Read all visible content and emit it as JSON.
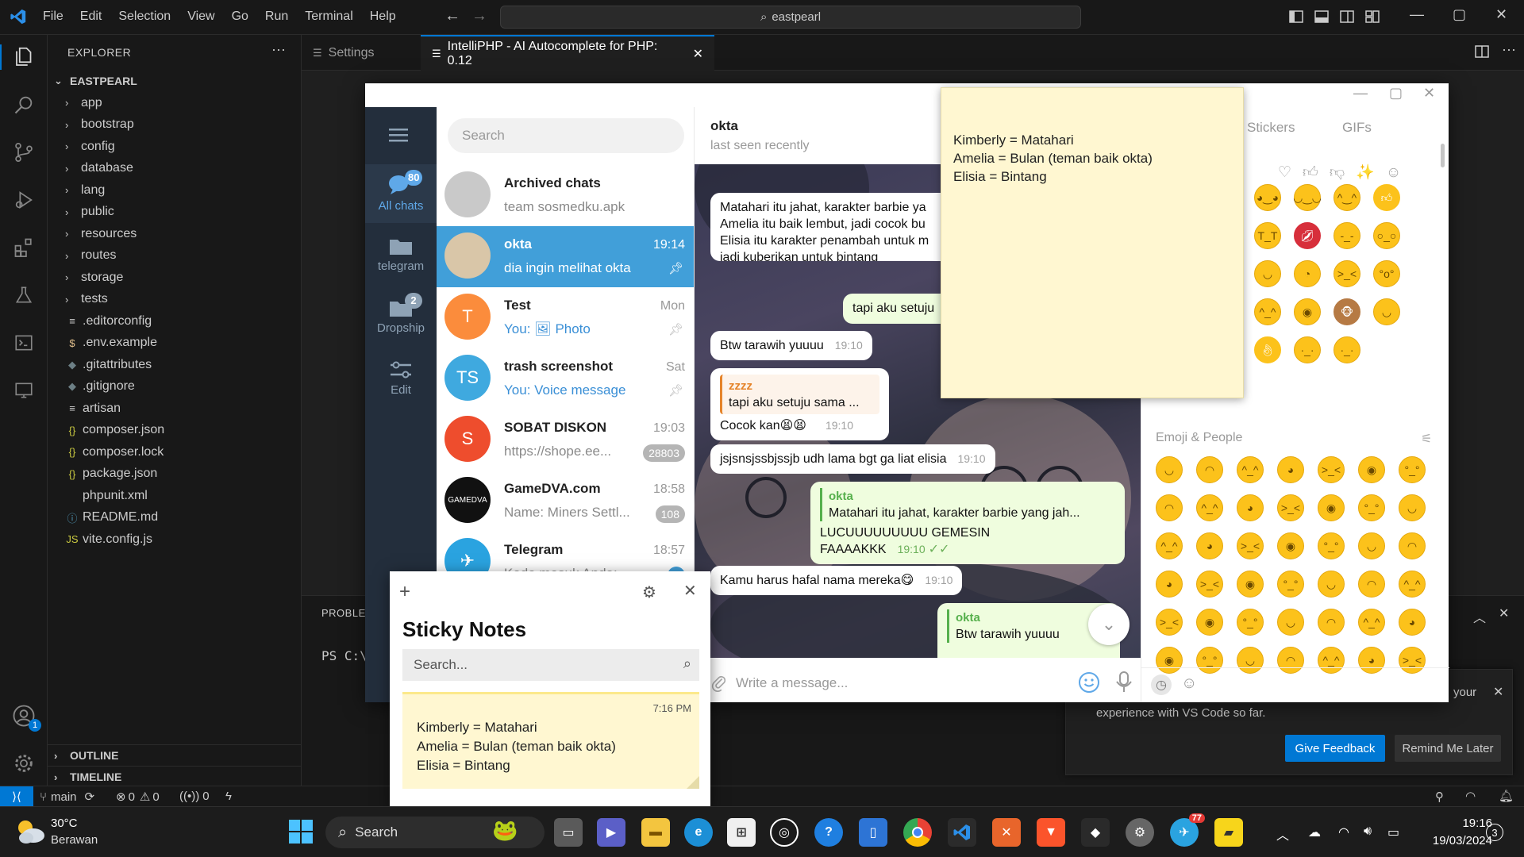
{
  "vscode": {
    "menu": [
      "File",
      "Edit",
      "Selection",
      "View",
      "Go",
      "Run",
      "Terminal",
      "Help"
    ],
    "search": "eastpearl",
    "explorer_title": "EXPLORER",
    "root_folder": "EASTPEARL",
    "folders": [
      "app",
      "bootstrap",
      "config",
      "database",
      "lang",
      "public",
      "resources",
      "routes",
      "storage",
      "tests"
    ],
    "files": [
      ".editorconfig",
      ".env.example",
      ".gitattributes",
      ".gitignore",
      "artisan",
      "composer.json",
      "composer.lock",
      "package.json",
      "phpunit.xml",
      "README.md",
      "vite.config.js"
    ],
    "outline": "OUTLINE",
    "timeline": "TIMELINE",
    "tab_settings": "Settings",
    "tab_active": "IntelliPHP - AI Autocomplete for PHP: 0.12",
    "panel_tab": "PROBLEM",
    "terminal_prompt": "PS C:\\",
    "accounts_badge": "1",
    "status": {
      "branch": "main",
      "errors": "0",
      "warnings": "0",
      "ports": "0"
    },
    "notification": {
      "text_tail": "your",
      "text_line2": "experience with VS Code so far.",
      "feedback_button": "Give Feedback",
      "later_button": "Remind Me Later"
    }
  },
  "telegram": {
    "search_placeholder": "Search",
    "nav": [
      {
        "label": "All chats",
        "badge": "80"
      },
      {
        "label": "telegram",
        "badge": ""
      },
      {
        "label": "Dropship",
        "badge": "2"
      },
      {
        "label": "Edit",
        "badge": ""
      }
    ],
    "chats": [
      {
        "name": "Archived chats",
        "msg": "team sosmedku.apk",
        "time": "",
        "badge": "",
        "avatar": "",
        "color": "#c9c9c9"
      },
      {
        "name": "okta",
        "msg": "dia ingin melihat okta te...",
        "time": "19:14",
        "badge": "",
        "avatar": "",
        "color": "#d9c6a8"
      },
      {
        "name": "Test",
        "msg": "You: 🖼 Photo",
        "time": "Mon",
        "badge": "",
        "avatar": "T",
        "color": "#fb8c3c"
      },
      {
        "name": "trash screenshot",
        "msg": "You: Voice message",
        "time": "Sat",
        "badge": "",
        "avatar": "TS",
        "color": "#3fa9df"
      },
      {
        "name": "SOBAT DISKON",
        "msg": "https://shope.ee...",
        "time": "19:03",
        "badge": "28803",
        "avatar": "S",
        "color": "#ee4d2d"
      },
      {
        "name": "GameDVA.com",
        "msg": "Name: Miners Settl...",
        "time": "18:58",
        "badge": "108",
        "avatar": "GAMEDVA",
        "color": "#111111"
      },
      {
        "name": "Telegram",
        "msg": "Kode masuk Anda:",
        "time": "18:57",
        "badge": "1",
        "avatar": "✈",
        "color": "#2aa3e0"
      }
    ],
    "chat_header": {
      "name": "okta",
      "status": "last seen recently"
    },
    "messages": {
      "m1": [
        "Matahari itu jahat, karakter barbie ya",
        "Amelia itu baik lembut, jadi cocok bu",
        "Elisia itu karakter penambah untuk m",
        "jadi kuberikan untuk bintang"
      ],
      "m2": "tapi aku setuju",
      "m3": {
        "text": "Btw tarawih yuuuu",
        "time": "19:10"
      },
      "m4": {
        "reply_name": "zzzz",
        "reply_text": "tapi aku setuju sama ...",
        "text": "Cocok kan😫😫",
        "time": "19:10"
      },
      "m5": {
        "text": "jsjsnsjssbjssjb udh lama bgt ga liat elisia",
        "time": "19:10"
      },
      "m6": {
        "reply_name": "okta",
        "reply_text": "Matahari itu jahat, karakter barbie yang jah...",
        "text": "LUCUUUUUUUUU GEMESIN FAAAAKKK",
        "time": "19:10"
      },
      "m7": {
        "text": "Kamu harus hafal nama mereka😋",
        "time": "19:10"
      },
      "m8": {
        "reply_name": "okta",
        "reply_text": "Btw tarawih yuuuu"
      }
    },
    "composer_placeholder": "Write a message...",
    "emoji_tabs": [
      "Stickers",
      "GIFs"
    ],
    "emoji_section": "Emoji & People"
  },
  "sticky": {
    "note_lines": [
      "Kimberly = Matahari",
      "Amelia = Bulan (teman baik okta)",
      "Elisia = Bintang"
    ],
    "title": "Sticky Notes",
    "search_placeholder": "Search...",
    "note_time": "7:16 PM"
  },
  "taskbar": {
    "weather_temp": "30°C",
    "weather_desc": "Berawan",
    "search_label": "Search",
    "telegram_badge": "77",
    "time": "19:16",
    "date": "19/03/2024",
    "notif_count": "3"
  },
  "colors": {
    "vscode_bg": "#1f1f1f",
    "vscode_accent": "#0078d4",
    "telegram_blue": "#419fd9",
    "telegram_nav": "#232e3c",
    "sticky_yellow": "#fff7d1"
  }
}
